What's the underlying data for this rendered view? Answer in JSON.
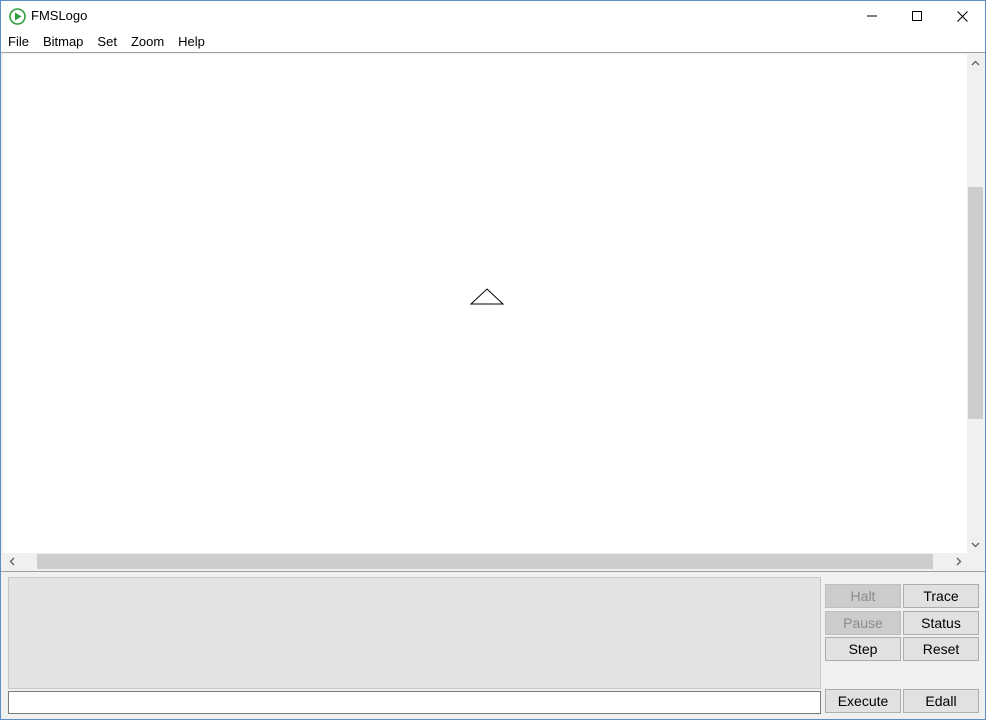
{
  "window": {
    "title": "FMSLogo",
    "accent_color": "#5a8ec5"
  },
  "titlebar_buttons": {
    "minimize_icon": "minimize-icon",
    "maximize_icon": "maximize-icon",
    "close_icon": "close-icon"
  },
  "menu": {
    "items": [
      "File",
      "Bitmap",
      "Set",
      "Zoom",
      "Help"
    ]
  },
  "canvas": {
    "turtle_icon": "turtle-triangle-icon",
    "background": "#ffffff"
  },
  "commander": {
    "input_value": "",
    "buttons": {
      "halt": "Halt",
      "trace": "Trace",
      "pause": "Pause",
      "status": "Status",
      "step": "Step",
      "reset": "Reset",
      "execute": "Execute",
      "edall": "Edall"
    }
  }
}
